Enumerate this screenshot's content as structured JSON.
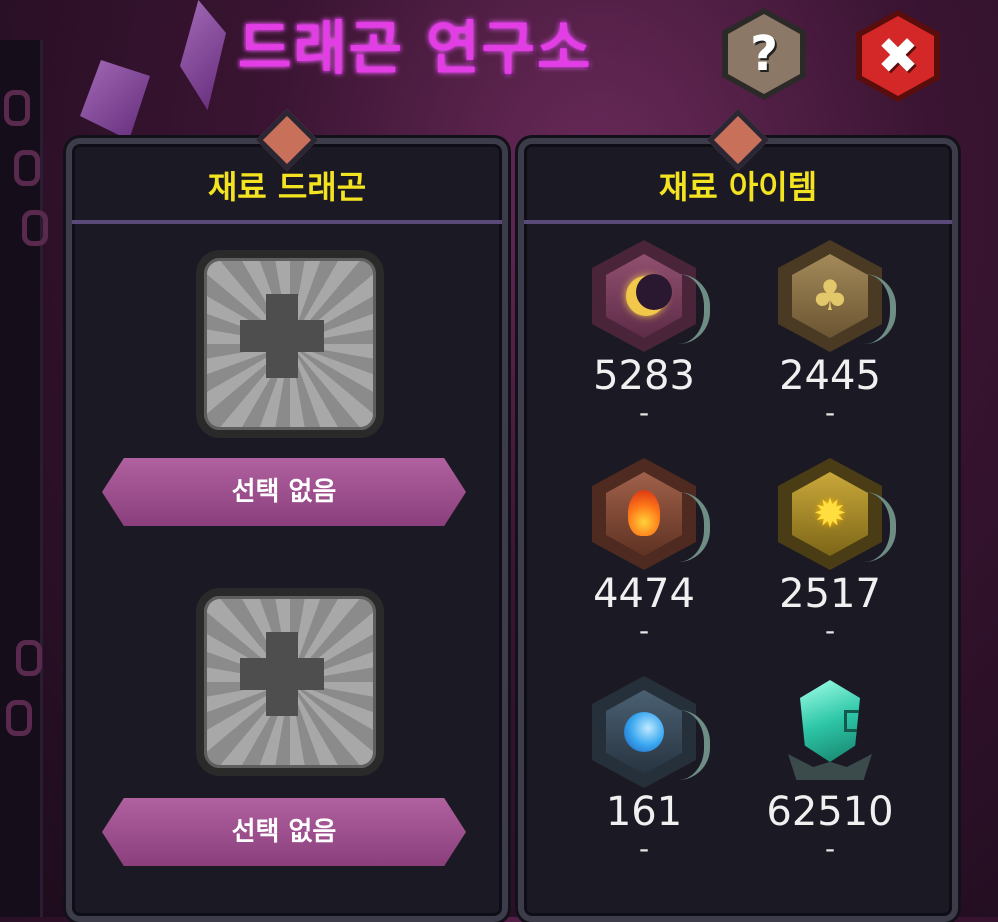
{
  "title": "드래곤 연구소",
  "header_buttons": {
    "help_glyph": "?",
    "close_glyph": "✖"
  },
  "left_panel": {
    "heading": "재료 드래곤",
    "slots": [
      {
        "button_label": "선택 없음"
      },
      {
        "button_label": "선택 없음"
      }
    ]
  },
  "right_panel": {
    "heading": "재료 아이템",
    "items": [
      {
        "icon": "moon-stone-icon",
        "count": "5283",
        "sub": "-"
      },
      {
        "icon": "tree-stone-icon",
        "count": "2445",
        "sub": "-"
      },
      {
        "icon": "fire-stone-icon",
        "count": "4474",
        "sub": "-"
      },
      {
        "icon": "sun-stone-icon",
        "count": "2517",
        "sub": "-"
      },
      {
        "icon": "water-stone-icon",
        "count": "161",
        "sub": "-"
      },
      {
        "icon": "crystal-icon",
        "count": "62510",
        "sub": "-"
      }
    ]
  },
  "colors": {
    "title": "#e33ee6",
    "heading": "#f3e321",
    "select_button": "#a0528f",
    "close_button": "#d42828",
    "help_button": "#8c7866"
  }
}
